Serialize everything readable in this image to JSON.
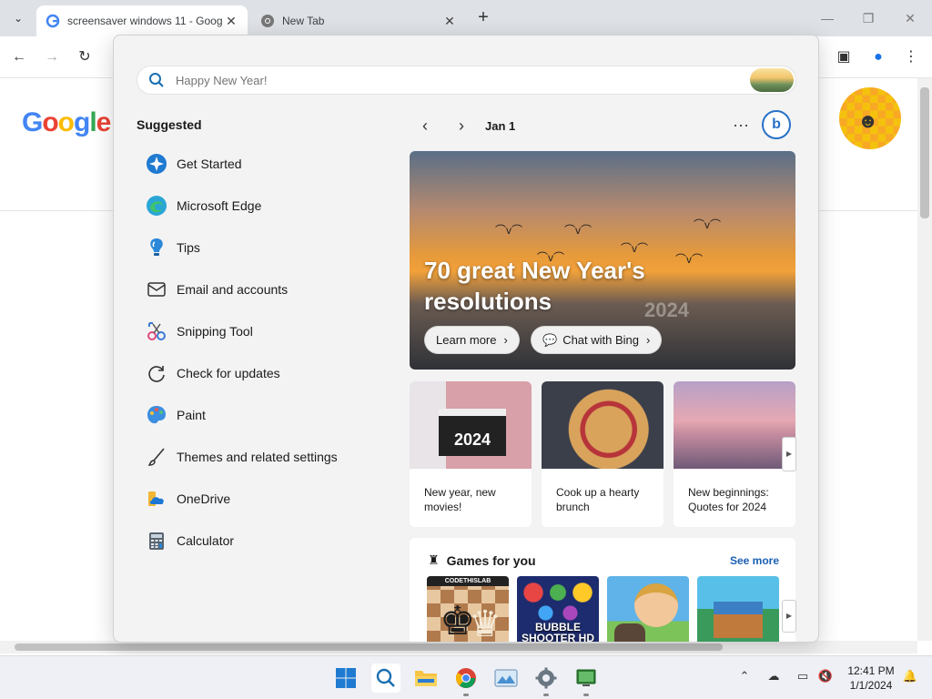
{
  "browser": {
    "tabs": [
      {
        "title": "screensaver windows 11 - Goog",
        "active": true
      },
      {
        "title": "New Tab",
        "active": false
      }
    ]
  },
  "google_doodle": {
    "letters": [
      "G",
      "o",
      "o",
      "g",
      "l",
      "e"
    ]
  },
  "search": {
    "placeholder": "Happy New Year!"
  },
  "suggested": {
    "title": "Suggested",
    "items": [
      {
        "label": "Get Started",
        "icon": "get-started-icon"
      },
      {
        "label": "Microsoft Edge",
        "icon": "edge-icon"
      },
      {
        "label": "Tips",
        "icon": "tips-icon"
      },
      {
        "label": "Email and accounts",
        "icon": "mail-icon"
      },
      {
        "label": "Snipping Tool",
        "icon": "snipping-tool-icon"
      },
      {
        "label": "Check for updates",
        "icon": "refresh-icon"
      },
      {
        "label": "Paint",
        "icon": "paint-icon"
      },
      {
        "label": "Themes and related settings",
        "icon": "brush-icon"
      },
      {
        "label": "OneDrive",
        "icon": "onedrive-icon"
      },
      {
        "label": "Calculator",
        "icon": "calculator-icon"
      }
    ]
  },
  "highlights": {
    "date": "Jan 1",
    "hero": {
      "title": "70 great New Year's resolutions",
      "watermark": "2024",
      "learn_more": "Learn more",
      "chat": "Chat with Bing"
    },
    "cards": [
      {
        "text": "New year, new movies!",
        "clapper": "2024"
      },
      {
        "text": "Cook up a hearty brunch"
      },
      {
        "text": "New beginnings: Quotes for 2024"
      }
    ],
    "games": {
      "title": "Games for you",
      "see_more": "See more",
      "tiles": [
        "CODETHISLAB",
        "BUBBLE SHOOTER HD",
        "",
        ""
      ]
    }
  },
  "taskbar": {
    "time": "12:41 PM",
    "date": "1/1/2024"
  }
}
